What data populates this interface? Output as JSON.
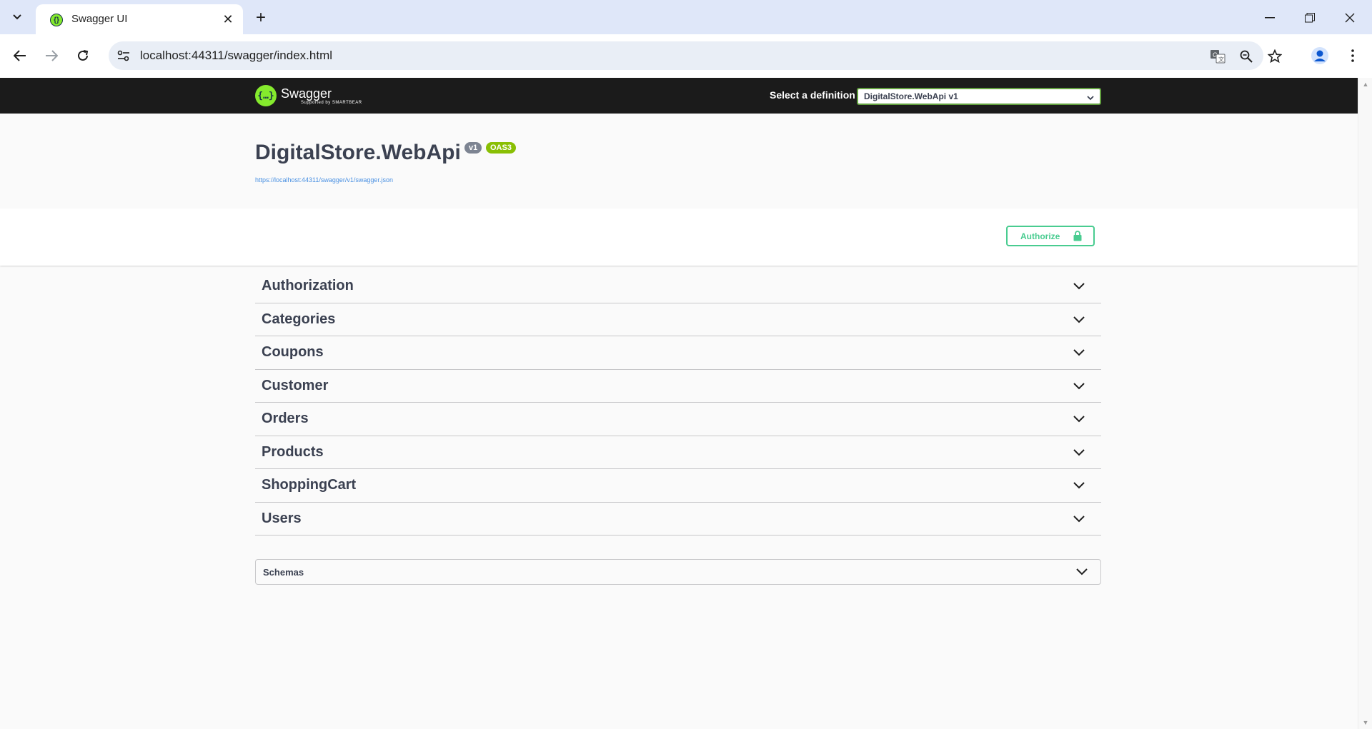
{
  "browser": {
    "tab_title": "Swagger UI",
    "url": "localhost:44311/swagger/index.html"
  },
  "topbar": {
    "logo_word": "Swagger",
    "logo_sub": "Supported by SMARTBEAR",
    "definition_label": "Select a definition",
    "definition_value": "DigitalStore.WebApi v1"
  },
  "info": {
    "title": "DigitalStore.WebApi",
    "version_badge": "v1",
    "oas_badge": "OAS3",
    "spec_url": "https://localhost:44311/swagger/v1/swagger.json"
  },
  "auth": {
    "authorize_label": "Authorize"
  },
  "tags": [
    {
      "name": "Authorization"
    },
    {
      "name": "Categories"
    },
    {
      "name": "Coupons"
    },
    {
      "name": "Customer"
    },
    {
      "name": "Orders"
    },
    {
      "name": "Products"
    },
    {
      "name": "ShoppingCart"
    },
    {
      "name": "Users"
    }
  ],
  "schemas": {
    "label": "Schemas"
  },
  "colors": {
    "topbar_bg": "#1b1b1b",
    "swagger_green": "#85ea2d",
    "authorize_green": "#49cc90",
    "oas_badge": "#89bf04",
    "version_badge": "#7d8492",
    "text": "#3b4151",
    "link": "#4990e2"
  }
}
